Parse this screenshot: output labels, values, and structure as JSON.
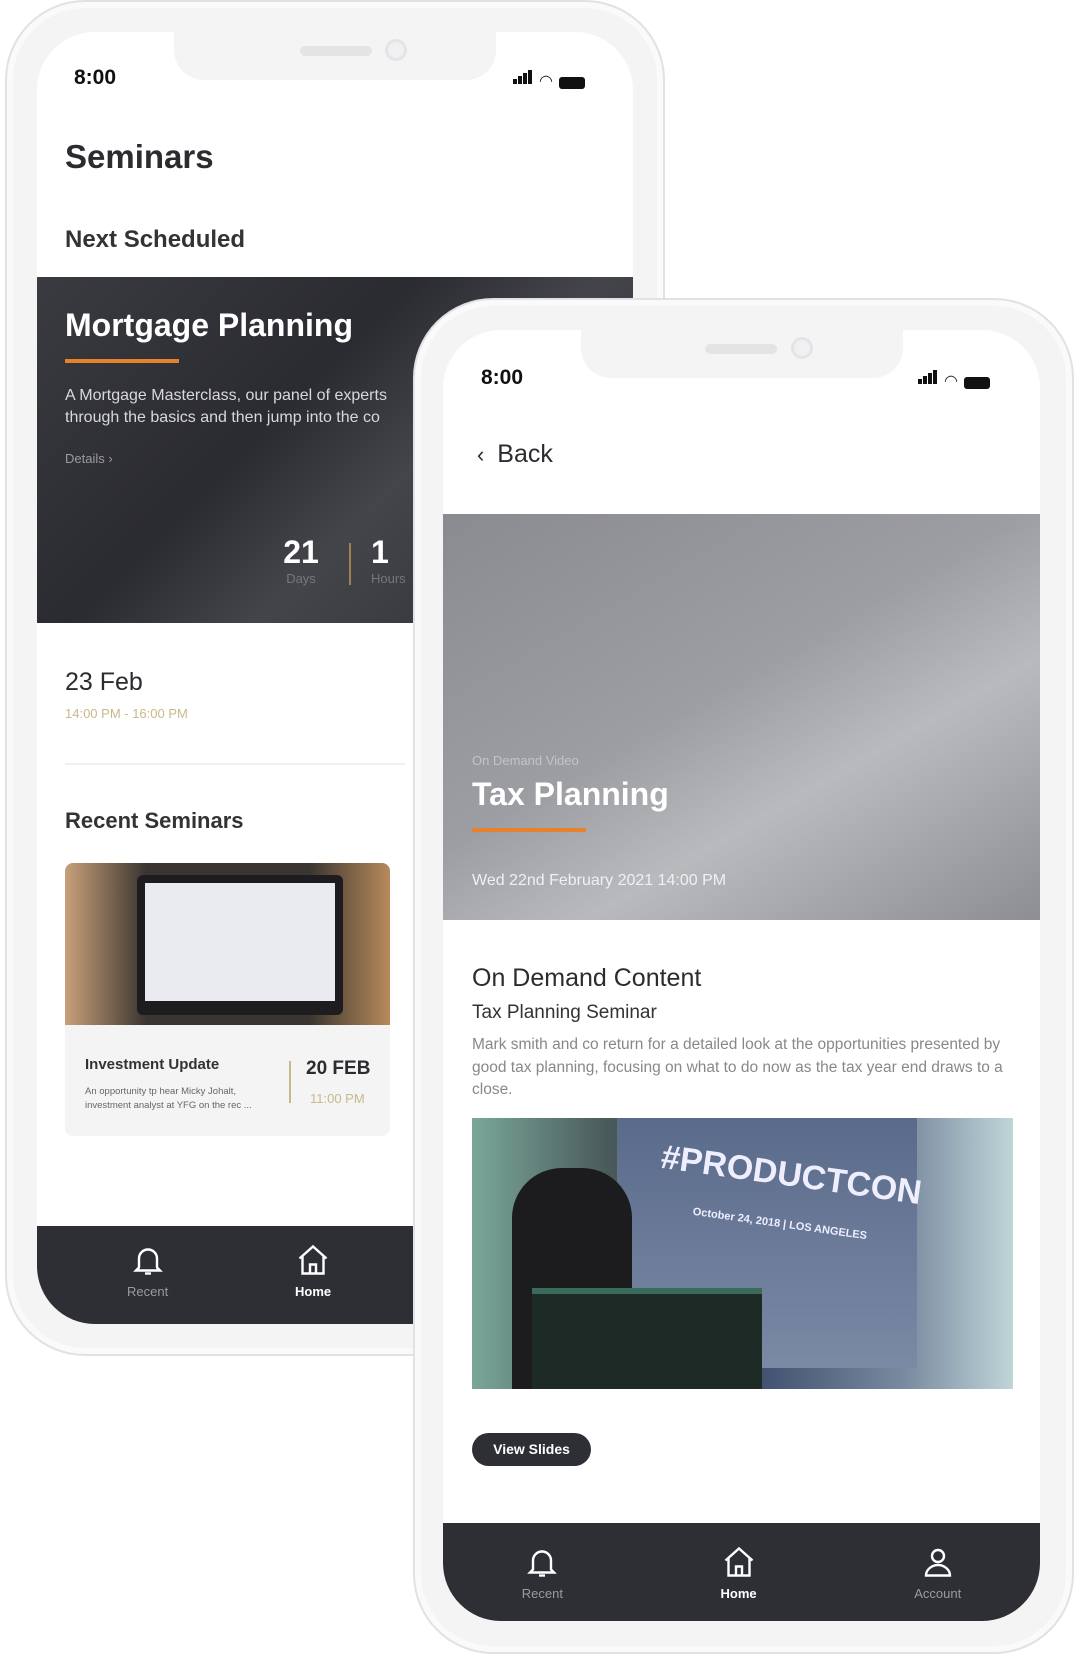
{
  "back_phone": {
    "status_time": "8:00",
    "page_title": "Seminars",
    "next_section_title": "Next Scheduled",
    "hero": {
      "title": "Mortgage Planning",
      "description_line1": "A Mortgage Masterclass, our panel of experts",
      "description_line2": "through the basics and then jump into the co",
      "details_link": "Details",
      "countdown": [
        {
          "value": "21",
          "unit": "Days"
        },
        {
          "value": "1",
          "unit": "Hours"
        }
      ]
    },
    "next_date": "23 Feb",
    "next_time": "14:00 PM - 16:00 PM",
    "recent_section_title": "Recent Seminars",
    "recent_card": {
      "title": "Investment Update",
      "description_line1": "An  opportunity tp hear Micky Johalt,",
      "description_line2": "investment analyst at YFG on the rec ...",
      "date": "20 FEB",
      "time": "11:00 PM"
    },
    "nav": [
      {
        "label": "Recent",
        "icon": "bell-icon"
      },
      {
        "label": "Home",
        "icon": "home-icon",
        "active": true
      }
    ]
  },
  "front_phone": {
    "status_time": "8:00",
    "back_label": "Back",
    "hero": {
      "kicker": "On Demand Video",
      "title": "Tax Planning",
      "date": "Wed 22nd February 2021 14:00 PM"
    },
    "section_title": "On Demand Content",
    "subtitle": "Tax Planning Seminar",
    "description": "Mark smith and co return for a detailed look at the opportunities presented by good tax planning, focusing on what to do now as the tax year end draws to a close.",
    "video_slide_text": "#PRODUCTCON",
    "video_slide_subtext": "October 24, 2018 | LOS ANGELES",
    "view_slides_label": "View Slides",
    "nav": [
      {
        "label": "Recent",
        "icon": "bell-icon"
      },
      {
        "label": "Home",
        "icon": "home-icon",
        "active": true
      },
      {
        "label": "Account",
        "icon": "user-icon"
      }
    ]
  },
  "colors": {
    "accent": "#e8822a",
    "dark": "#2e2f35",
    "gold": "#c8b98a"
  }
}
